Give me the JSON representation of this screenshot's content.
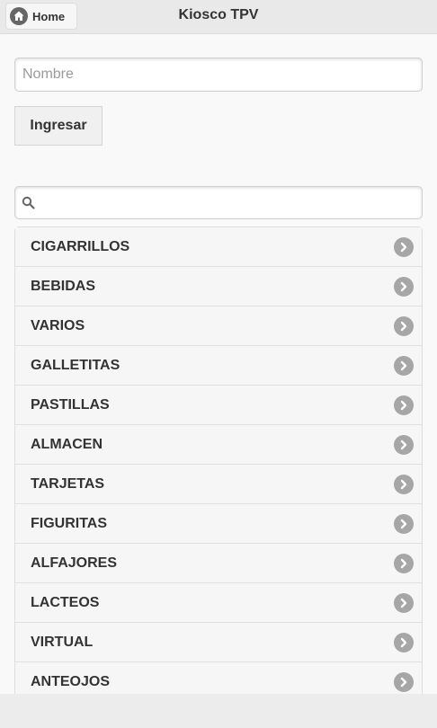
{
  "header": {
    "home_label": "Home",
    "title": "Kiosco TPV",
    "home_icon": "home-icon"
  },
  "form": {
    "name_placeholder": "Nombre",
    "name_value": "",
    "submit_label": "Ingresar"
  },
  "search": {
    "value": "",
    "icon": "search-icon"
  },
  "categories": [
    {
      "label": "CIGARRILLOS"
    },
    {
      "label": "BEBIDAS"
    },
    {
      "label": "VARIOS"
    },
    {
      "label": "GALLETITAS"
    },
    {
      "label": "PASTILLAS"
    },
    {
      "label": "ALMACEN"
    },
    {
      "label": "TARJETAS"
    },
    {
      "label": "FIGURITAS"
    },
    {
      "label": "ALFAJORES"
    },
    {
      "label": "LACTEOS"
    },
    {
      "label": "VIRTUAL"
    },
    {
      "label": "ANTEOJOS"
    }
  ],
  "colors": {
    "header_bg": "#e9e9e9",
    "list_bg": "#f6f6f6",
    "arrow_bg": "#a6a6a6"
  }
}
